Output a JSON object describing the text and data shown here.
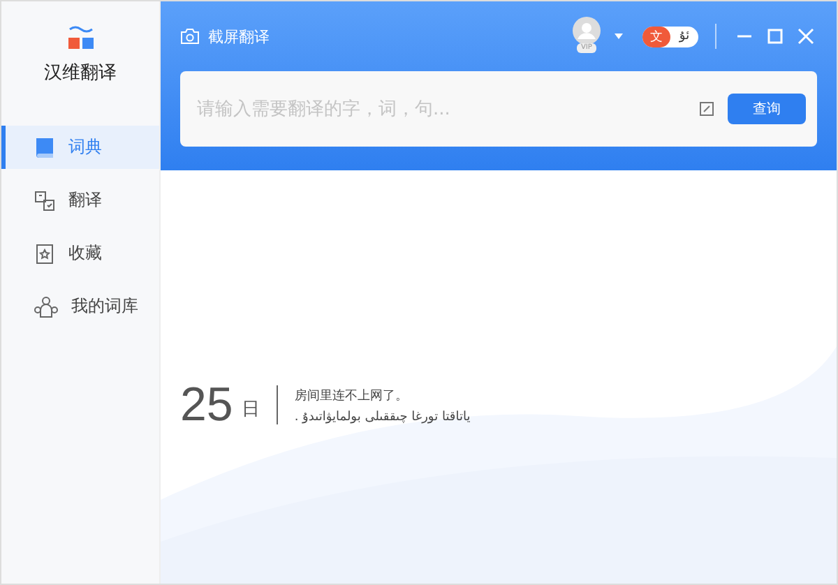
{
  "app": {
    "name": "汉维翻译"
  },
  "sidebar": {
    "items": [
      {
        "kind": "dictionary",
        "label": "词典",
        "selected": true
      },
      {
        "kind": "translate",
        "label": "翻译",
        "selected": false
      },
      {
        "kind": "favorites",
        "label": "收藏",
        "selected": false
      },
      {
        "kind": "wordbank",
        "label": "我的词库",
        "selected": false
      }
    ]
  },
  "header": {
    "screenshot_translate": "截屏翻译",
    "vip_badge": "VIP",
    "language_toggle": [
      {
        "label": "文",
        "selected": true
      },
      {
        "label": "ئۇ",
        "selected": false
      }
    ]
  },
  "search": {
    "placeholder": "请输入需要翻译的字，词，句...",
    "button": "查询"
  },
  "daily": {
    "day": "25",
    "day_unit": "日",
    "chinese": "房间里连不上网了。",
    "uyghur": "ياتاقتا تورغا چىققىلى بولمايۋاتىدۇ ."
  }
}
